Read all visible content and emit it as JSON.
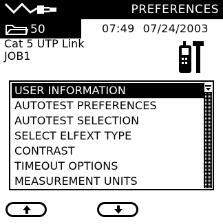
{
  "header": {
    "title": "PREFERENCES",
    "logo_icon": "cable-test-logo-icon"
  },
  "status": {
    "folder_icon": "folder-icon",
    "folder_count": "50",
    "time": "07:49",
    "date": "07/24/2003"
  },
  "job": {
    "link_label": "Cat 5 UTP Link",
    "job_id": "JOB1",
    "tester_icon": "tester-and-tool-icon"
  },
  "menu": {
    "items": [
      {
        "label": "USER INFORMATION",
        "selected": true
      },
      {
        "label": "AUTOTEST PREFERENCES",
        "selected": false
      },
      {
        "label": "AUTOTEST SELECTION",
        "selected": false
      },
      {
        "label": "SELECT ELFEXT TYPE",
        "selected": false
      },
      {
        "label": "CONTRAST",
        "selected": false
      },
      {
        "label": "TIMEOUT OPTIONS",
        "selected": false
      },
      {
        "label": "MEASUREMENT UNITS",
        "selected": false
      }
    ]
  },
  "softkeys": {
    "up_icon": "arrow-up-icon",
    "down_icon": "arrow-down-icon"
  }
}
